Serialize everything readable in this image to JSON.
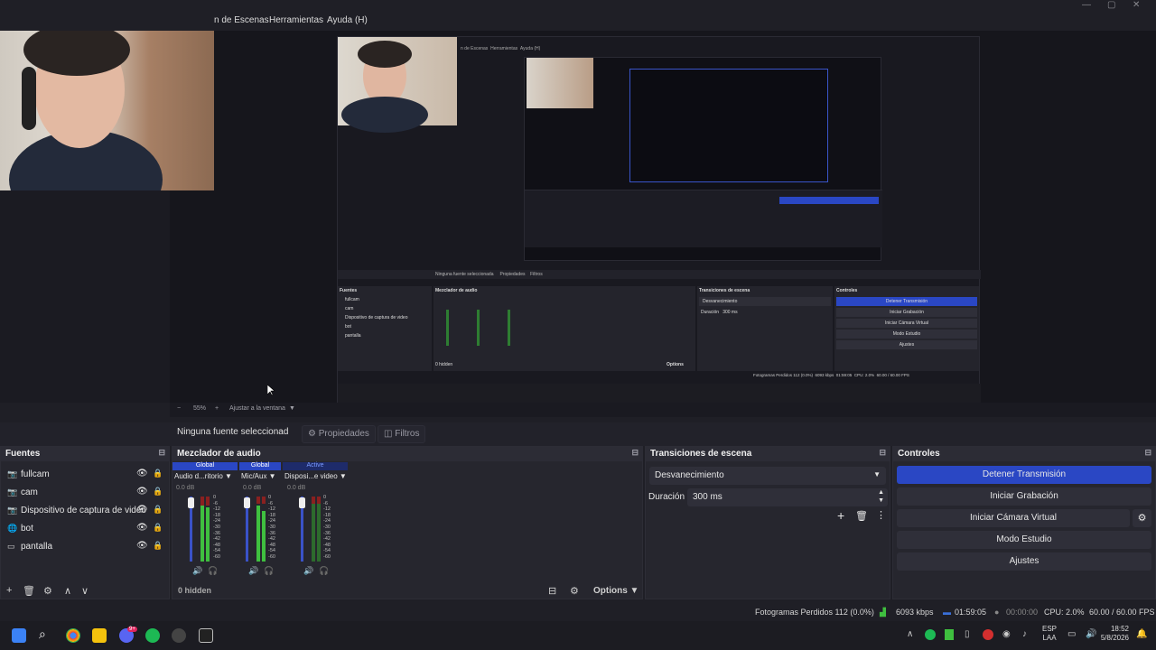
{
  "menu": {
    "items": [
      "n de Escenas",
      "Herramientas",
      "Ayuda (H)"
    ]
  },
  "preview": {
    "zoom_value": "55%",
    "fit_label": "Ajustar a la ventana",
    "nested_menu": [
      "n de Escenas",
      "Herramientas",
      "Ayuda (H)"
    ],
    "nested_sources_title": "Fuentes",
    "nested_sources": [
      "fullcam",
      "cam",
      "Dispositivo de captura de video",
      "bot",
      "pantalla"
    ],
    "nested_no_source": "Ninguna fuente seleccionada",
    "nested_props": "Propiedades",
    "nested_filters": "Filtros",
    "nested_mixer_title": "Mezclador de audio",
    "nested_transitions_title": "Transiciones de escena",
    "nested_controls_title": "Controles",
    "nested_transition": "Desvanecimiento",
    "nested_duration_label": "Duración",
    "nested_duration_value": "300 ms",
    "nested_controls": [
      "Detener Transmisión",
      "Iniciar Grabación",
      "Iniciar Cámara Virtual",
      "Modo Estudio",
      "Ajustes"
    ],
    "nested_hidden": "0 hidden",
    "nested_options": "Options",
    "nested_status": "Fotogramas Perdidos 112 (0.0%)",
    "nested_kbps": "6093 kbps",
    "nested_time": "01:59:05",
    "nested_cpu": "CPU: 2.0%",
    "nested_fps": "60.00 / 60.00 FPS"
  },
  "source_bar": {
    "no_source": "Ninguna fuente seleccionad",
    "properties_label": "Propiedades",
    "filters_label": "Filtros"
  },
  "sources_dock": {
    "title": "Fuentes",
    "items": [
      {
        "label": "fullcam",
        "icon": "camera-icon"
      },
      {
        "label": "cam",
        "icon": "camera-icon"
      },
      {
        "label": "Dispositivo de captura de video",
        "icon": "camera-icon"
      },
      {
        "label": "bot",
        "icon": "browser-icon"
      },
      {
        "label": "pantalla",
        "icon": "monitor-icon"
      }
    ]
  },
  "mixer_dock": {
    "title": "Mezclador de audio",
    "channels": [
      {
        "badge": "Global",
        "name": "Audio d...ritorio",
        "db": "0.0 dB"
      },
      {
        "badge": "Global",
        "name": "Mic/Aux",
        "db": "0.0 dB"
      },
      {
        "badge": "Active",
        "name": "Disposi...e video",
        "db": "0.0 dB"
      }
    ],
    "scale": [
      "0",
      "-6",
      "-12",
      "-18",
      "-24",
      "-30",
      "-36",
      "-42",
      "-48",
      "-54",
      "-60"
    ],
    "hidden_label": "0 hidden",
    "options_label": "Options"
  },
  "transitions_dock": {
    "title": "Transiciones de escena",
    "transition": "Desvanecimiento",
    "duration_label": "Duración",
    "duration_value": "300 ms"
  },
  "controls_dock": {
    "title": "Controles",
    "stream_button": "Detener Transmisión",
    "record_button": "Iniciar Grabación",
    "virtualcam_button": "Iniciar Cámara Virtual",
    "studio_button": "Modo Estudio",
    "settings_button": "Ajustes"
  },
  "status": {
    "dropped": "Fotogramas Perdidos 112 (0.0%)",
    "kbps": "6093 kbps",
    "stream_time": "01:59:05",
    "record_time": "00:00:00",
    "cpu": "CPU: 2.0%",
    "fps": "60.00 / 60.00 FPS"
  },
  "taskbar": {
    "lang_top": "ESP",
    "lang_bottom": "LAA",
    "time": "18:52",
    "date": "5/8/2026",
    "discord_badge": "9+"
  },
  "colors": {
    "accent": "#2a47c4",
    "bg": "#1f1f26",
    "dock": "#26262e"
  }
}
